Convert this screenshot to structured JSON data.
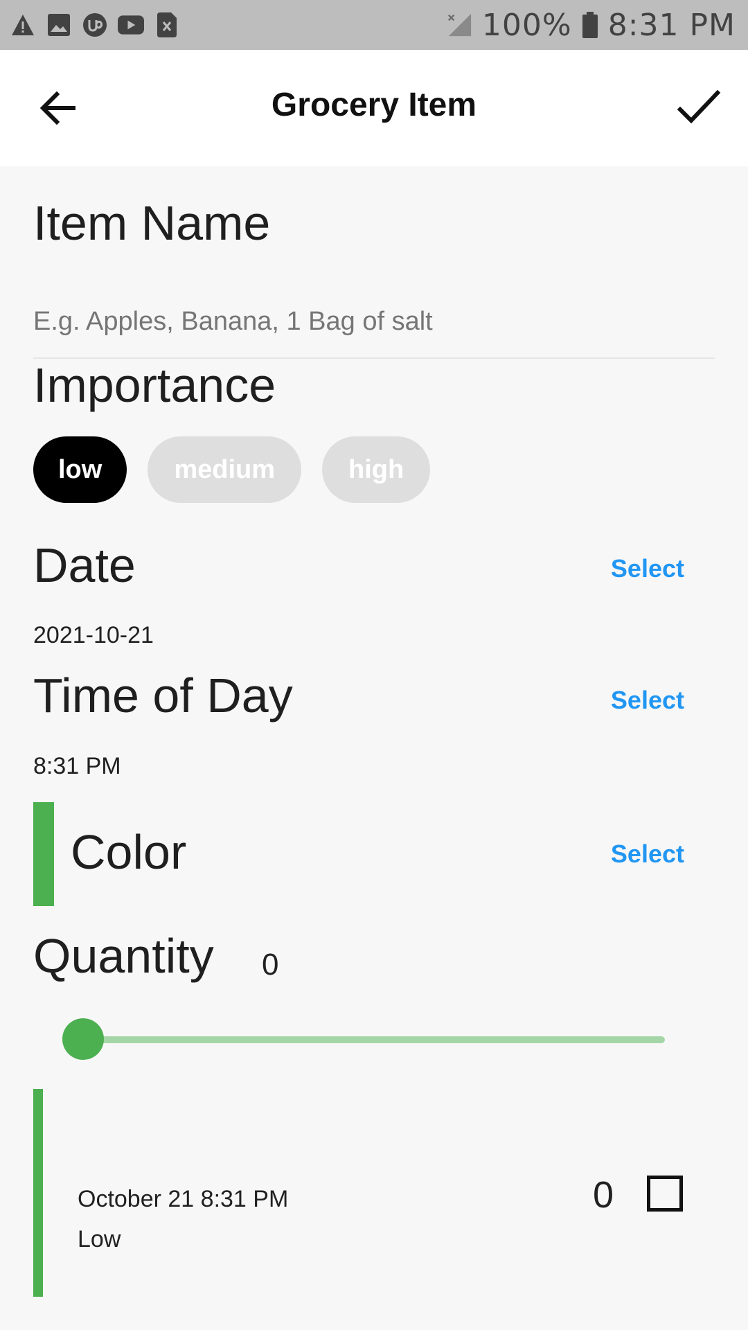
{
  "status_bar": {
    "battery": "100%",
    "time": "8:31 PM",
    "icons_left": [
      "warning-icon",
      "image-icon",
      "upwork-icon",
      "youtube-icon",
      "sim-x-icon"
    ],
    "icons_right": [
      "no-signal-icon",
      "battery-icon"
    ]
  },
  "app_bar": {
    "title": "Grocery Item",
    "back_icon": "arrow-left-icon",
    "save_icon": "check-icon"
  },
  "form": {
    "item_name": {
      "label": "Item Name",
      "value": "",
      "placeholder": "E.g. Apples, Banana, 1 Bag of salt"
    },
    "importance": {
      "label": "Importance",
      "options": [
        "low",
        "medium",
        "high"
      ],
      "selected": "low"
    },
    "date": {
      "label": "Date",
      "select_label": "Select",
      "value": "2021-10-21"
    },
    "time": {
      "label": "Time of Day",
      "select_label": "Select",
      "value": "8:31 PM"
    },
    "color": {
      "label": "Color",
      "select_label": "Select",
      "value": "#4caf50"
    },
    "quantity": {
      "label": "Quantity",
      "value": "0",
      "slider_fraction": 0
    }
  },
  "preview": {
    "date_time": "October 21 8:31 PM",
    "importance": "Low",
    "quantity": "0",
    "checked": false
  },
  "colors": {
    "accent": "#4caf50",
    "link": "#2196f3",
    "chip_active": "#000000",
    "chip_inactive": "#dedede"
  }
}
